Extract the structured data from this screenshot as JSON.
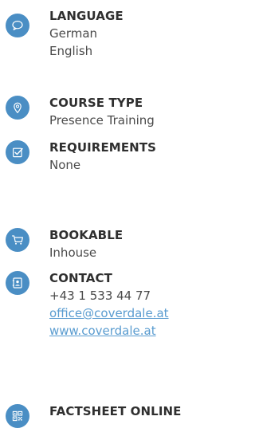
{
  "accent_color": "#4a8ec4",
  "items": [
    {
      "icon": "speech-bubble-icon",
      "title": "LANGUAGE",
      "lines": [
        "German",
        "English"
      ]
    },
    {
      "icon": "location-pin-icon",
      "title": "COURSE TYPE",
      "lines": [
        "Presence Training"
      ]
    },
    {
      "icon": "checkbox-icon",
      "title": "REQUIREMENTS",
      "lines": [
        "None"
      ]
    },
    {
      "icon": "shopping-cart-icon",
      "title": "BOOKABLE",
      "lines": [
        "Inhouse"
      ]
    },
    {
      "icon": "address-book-icon",
      "title": "CONTACT",
      "lines": [
        "+43 1 533 44 77"
      ],
      "links": [
        "office@coverdale.at",
        "www.coverdale.at"
      ]
    },
    {
      "icon": "qr-code-icon",
      "title": "FACTSHEET ONLINE",
      "lines": []
    }
  ]
}
